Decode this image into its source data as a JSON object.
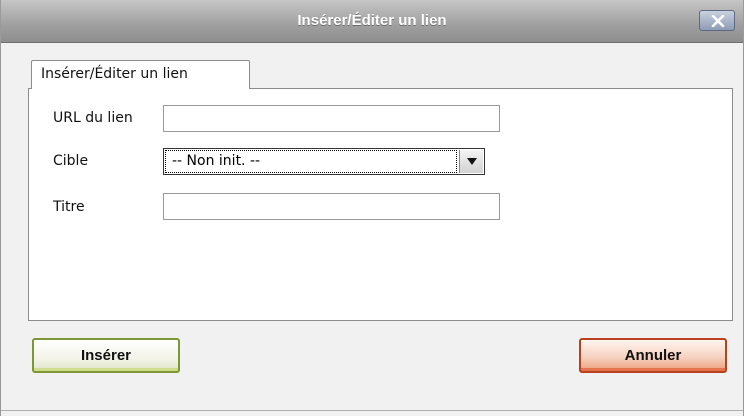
{
  "dialog": {
    "title": "Insérer/Éditer un lien"
  },
  "tabs": [
    {
      "label": "Insérer/Éditer un lien",
      "active": true
    }
  ],
  "form": {
    "url_label": "URL du lien",
    "url_value": "",
    "target_label": "Cible",
    "target_selected": "-- Non init. --",
    "title_label": "Titre",
    "title_value": ""
  },
  "buttons": {
    "insert_label": "Insérer",
    "cancel_label": "Annuler"
  },
  "colors": {
    "insert_accent": "#7e9635",
    "cancel_accent": "#b84220",
    "titlebar": "#9f9f9f"
  },
  "icons": {
    "close": "close-icon",
    "dropdown": "chevron-down-icon"
  }
}
